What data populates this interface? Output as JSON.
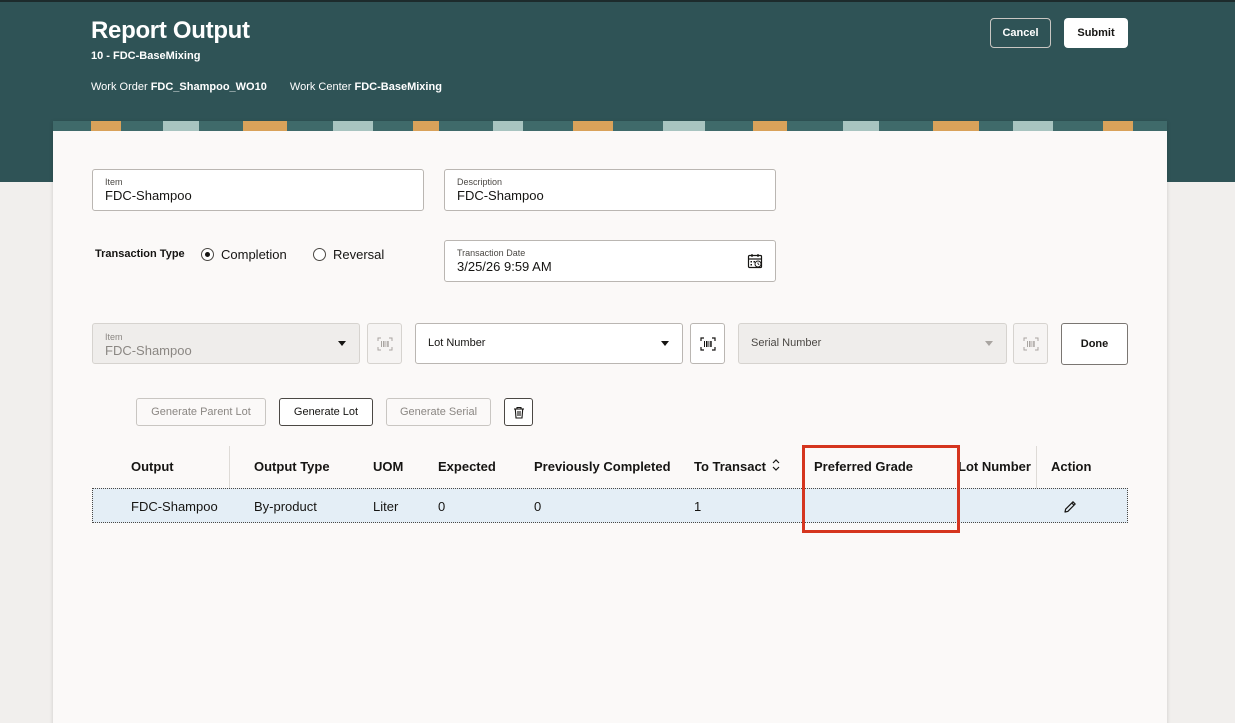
{
  "header": {
    "title": "Report Output",
    "subtitle": "10 - FDC-BaseMixing",
    "work_order_label": "Work Order",
    "work_order_value": "FDC_Shampoo_WO10",
    "work_center_label": "Work Center",
    "work_center_value": "FDC-BaseMixing",
    "cancel_label": "Cancel",
    "submit_label": "Submit"
  },
  "form": {
    "item_label": "Item",
    "item_value": "FDC-Shampoo",
    "description_label": "Description",
    "description_value": "FDC-Shampoo",
    "transaction_type_label": "Transaction Type",
    "completion_label": "Completion",
    "reversal_label": "Reversal",
    "selected_transaction_type": "Completion",
    "transaction_date_label": "Transaction Date",
    "transaction_date_value": "3/25/26 9:59 AM"
  },
  "entry": {
    "item_label": "Item",
    "item_value": "FDC-Shampoo",
    "lot_number_placeholder": "Lot Number",
    "serial_number_placeholder": "Serial Number",
    "done_label": "Done"
  },
  "actions": {
    "generate_parent_lot": "Generate Parent Lot",
    "generate_lot": "Generate Lot",
    "generate_serial": "Generate Serial"
  },
  "table": {
    "columns": [
      "Output",
      "Output Type",
      "UOM",
      "Expected",
      "Previously Completed",
      "To Transact",
      "Preferred Grade",
      "Lot Number",
      "Action"
    ],
    "rows": [
      {
        "output": "FDC-Shampoo",
        "output_type": "By-product",
        "uom": "Liter",
        "expected": "0",
        "previously_completed": "0",
        "to_transact": "1",
        "preferred_grade": "",
        "lot_number": ""
      }
    ]
  },
  "icons": {
    "calendar": "calendar-icon",
    "barcode": "barcode-scan-icon",
    "trash": "trash-icon",
    "edit": "pencil-edit-icon",
    "sort": "sort-icon"
  },
  "colors": {
    "header_bg": "#2f5356",
    "highlight": "#d5351f",
    "row_selected": "#e4eef6"
  }
}
